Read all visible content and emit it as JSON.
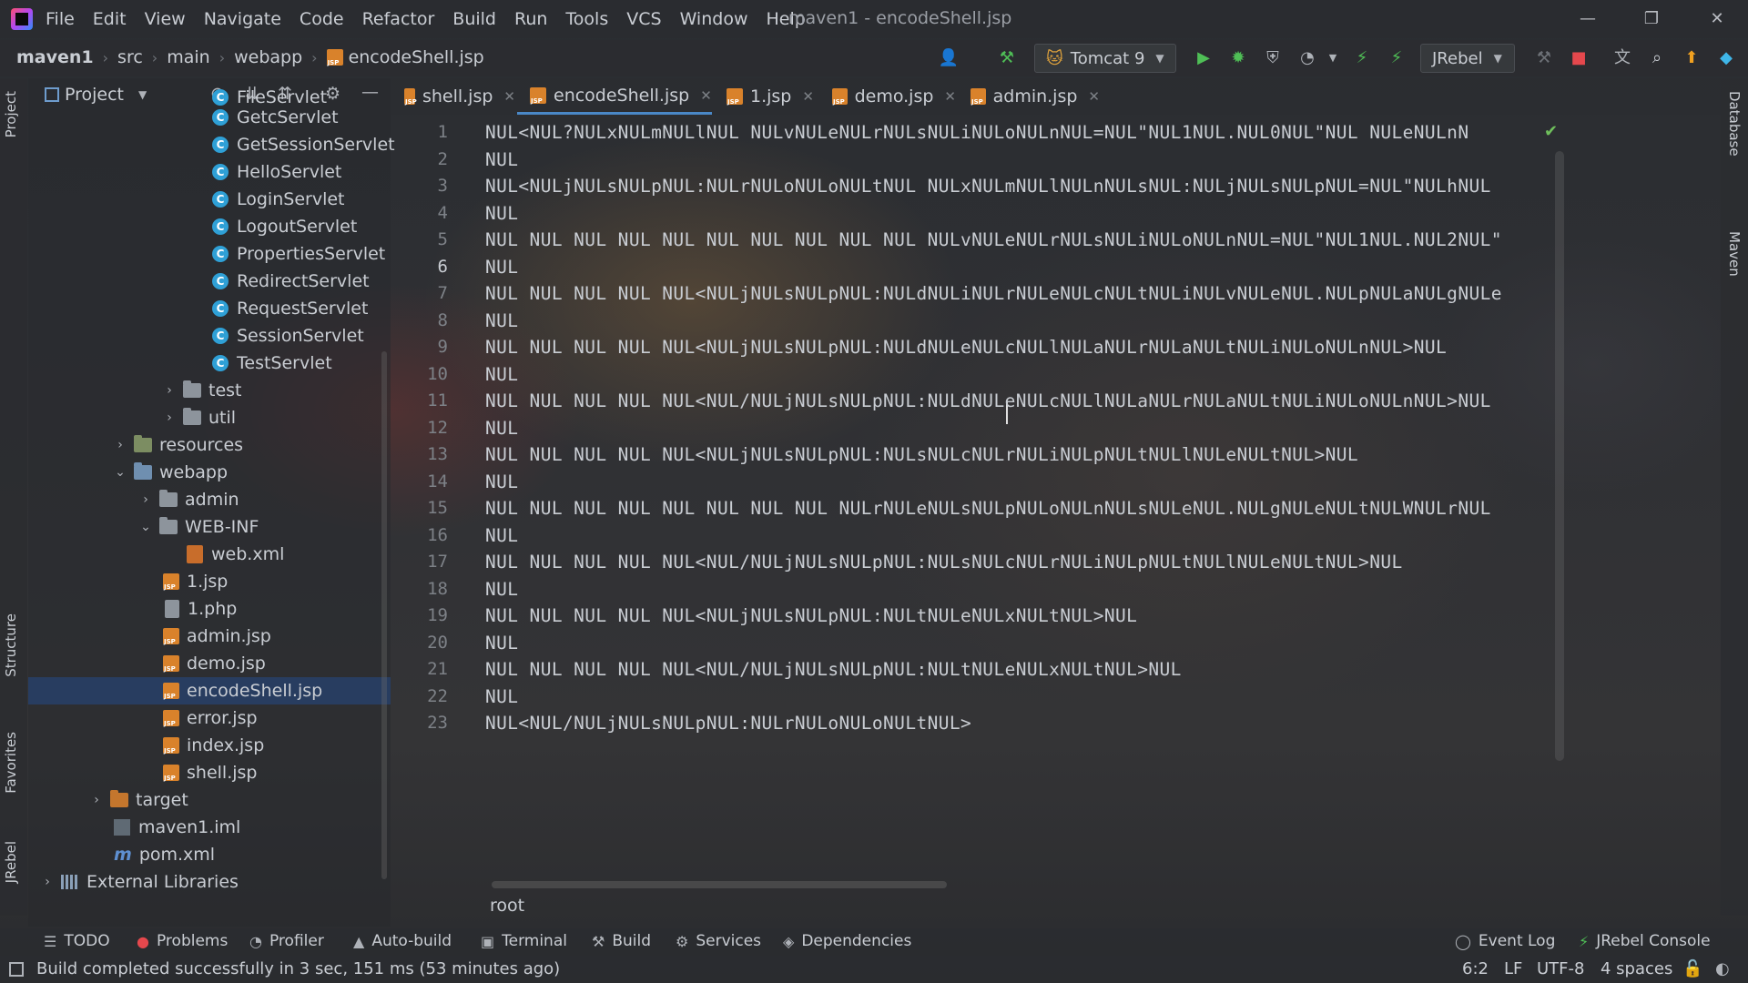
{
  "window": {
    "title": "maven1 - encodeShell.jsp",
    "controls": {
      "minimize": "—",
      "restore": "❐",
      "close": "✕"
    }
  },
  "menu": [
    "File",
    "Edit",
    "View",
    "Navigate",
    "Code",
    "Refactor",
    "Build",
    "Run",
    "Tools",
    "VCS",
    "Window",
    "Help"
  ],
  "breadcrumb": [
    "maven1",
    "src",
    "main",
    "webapp",
    "encodeShell.jsp"
  ],
  "toolbar": {
    "run_config": "Tomcat 9",
    "jrebel_label": "JRebel"
  },
  "left_tabs": {
    "project": "Project",
    "structure": "Structure",
    "favorites": "Favorites",
    "jrebel": "JRebel"
  },
  "right_tabs": {
    "database": "Database",
    "maven": "Maven"
  },
  "project_panel": {
    "title": "Project",
    "tree": [
      {
        "label": "FileServlet",
        "kind": "class"
      },
      {
        "label": "GetcServlet",
        "kind": "class"
      },
      {
        "label": "GetSessionServlet",
        "kind": "class"
      },
      {
        "label": "HelloServlet",
        "kind": "class"
      },
      {
        "label": "LoginServlet",
        "kind": "class"
      },
      {
        "label": "LogoutServlet",
        "kind": "class"
      },
      {
        "label": "PropertiesServlet",
        "kind": "class"
      },
      {
        "label": "RedirectServlet",
        "kind": "class"
      },
      {
        "label": "RequestServlet",
        "kind": "class"
      },
      {
        "label": "SessionServlet",
        "kind": "class"
      },
      {
        "label": "TestServlet",
        "kind": "class"
      },
      {
        "label": "test",
        "kind": "folder"
      },
      {
        "label": "util",
        "kind": "folder"
      },
      {
        "label": "resources",
        "kind": "folder"
      },
      {
        "label": "webapp",
        "kind": "folder"
      },
      {
        "label": "admin",
        "kind": "folder"
      },
      {
        "label": "WEB-INF",
        "kind": "folder"
      },
      {
        "label": "web.xml",
        "kind": "xml"
      },
      {
        "label": "1.jsp",
        "kind": "jsp"
      },
      {
        "label": "1.php",
        "kind": "file"
      },
      {
        "label": "admin.jsp",
        "kind": "jsp"
      },
      {
        "label": "demo.jsp",
        "kind": "jsp"
      },
      {
        "label": "encodeShell.jsp",
        "kind": "jsp",
        "selected": true
      },
      {
        "label": "error.jsp",
        "kind": "jsp"
      },
      {
        "label": "index.jsp",
        "kind": "jsp"
      },
      {
        "label": "shell.jsp",
        "kind": "jsp"
      },
      {
        "label": "target",
        "kind": "folder"
      },
      {
        "label": "maven1.iml",
        "kind": "iml"
      },
      {
        "label": "pom.xml",
        "kind": "maven"
      },
      {
        "label": "External Libraries",
        "kind": "library"
      }
    ]
  },
  "editor": {
    "tabs": [
      {
        "label": "shell.jsp",
        "active": false
      },
      {
        "label": "encodeShell.jsp",
        "active": true
      },
      {
        "label": "1.jsp",
        "active": false
      },
      {
        "label": "demo.jsp",
        "active": false
      },
      {
        "label": "admin.jsp",
        "active": false
      }
    ],
    "current_line": 6,
    "lines": [
      "NUL<NUL?NULxNULmNULlNUL NULvNULeNULrNULsNULiNULoNULnNUL=NUL\"NUL1NUL.NUL0NUL\"NUL NULeNULnN",
      "NUL",
      "NUL<NULjNULsNULpNUL:NULrNULoNULoNULtNUL NULxNULmNULlNULnNULsNUL:NULjNULsNULpNUL=NUL\"NULhNUL",
      "NUL",
      "NUL NUL NUL NUL NUL NUL NUL NUL NUL NUL NULvNULeNULrNULsNULiNULoNULnNUL=NUL\"NUL1NUL.NUL2NUL\"",
      "NUL",
      "NUL NUL NUL NUL NUL<NULjNULsNULpNUL:NULdNULiNULrNULeNULcNULtNULiNULvNULeNUL.NULpNULaNULgNULe",
      "NUL",
      "NUL NUL NUL NUL NUL<NULjNULsNULpNUL:NULdNULeNULcNULlNULaNULrNULaNULtNULiNULoNULnNUL>NUL",
      "NUL",
      "NUL NUL NUL NUL NUL<NUL/NULjNULsNULpNUL:NULdNULeNULcNULlNULaNULrNULaNULtNULiNULoNULnNUL>NUL",
      "NUL",
      "NUL NUL NUL NUL NUL<NULjNULsNULpNUL:NULsNULcNULrNULiNULpNULtNULlNULeNULtNUL>NUL",
      "NUL",
      "NUL NUL NUL NUL NUL NUL NUL NUL NULrNULeNULsNULpNULoNULnNULsNULeNUL.NULgNULeNULtNULWNULrNUL",
      "NUL",
      "NUL NUL NUL NUL NUL<NUL/NULjNULsNULpNUL:NULsNULcNULrNULiNULpNULtNULlNULeNULtNUL>NUL",
      "NUL",
      "NUL NUL NUL NUL NUL<NULjNULsNULpNUL:NULtNULeNULxNULtNUL>NUL",
      "NUL",
      "NUL NUL NUL NUL NUL<NUL/NULjNULsNULpNUL:NULtNULeNULxNULtNUL>NUL",
      "NUL",
      "NUL<NUL/NULjNULsNULpNUL:NULrNULoNULoNULtNUL>"
    ],
    "footer_breadcrumb": "root"
  },
  "tool_windows": [
    "TODO",
    "Problems",
    "Profiler",
    "Auto-build",
    "Terminal",
    "Build",
    "Services",
    "Dependencies",
    "Event Log",
    "JRebel Console"
  ],
  "status": {
    "message": "Build completed successfully in 3 sec, 151 ms (53 minutes ago)",
    "position": "6:2",
    "line_sep": "LF",
    "encoding": "UTF-8",
    "indent": "4 spaces"
  },
  "colors": {
    "accent": "#4a88c7",
    "selection": "#26416e",
    "run": "#4fbf56",
    "stop": "#e5484d",
    "jsp": "#d9822b",
    "class": "#2fa0d6"
  },
  "icons": {
    "search": "search-icon",
    "settings": "gear-icon",
    "run": "run-icon",
    "debug": "debug-icon",
    "stop": "stop-icon",
    "hammer": "build-hammer-icon"
  }
}
